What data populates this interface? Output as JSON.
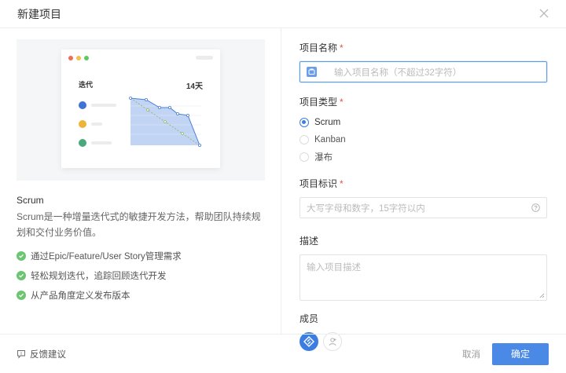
{
  "dialog": {
    "title": "新建项目"
  },
  "preview": {
    "card_label": "迭代",
    "card_days": "14天"
  },
  "template": {
    "name": "Scrum",
    "description": "Scrum是一种增量迭代式的敏捷开发方法，帮助团队持续规划和交付业务价值。",
    "features": [
      "通过Epic/Feature/User Story管理需求",
      "轻松规划迭代，追踪回顾迭代开发",
      "从产品角度定义发布版本"
    ]
  },
  "form": {
    "name_label": "项目名称",
    "name_placeholder": "输入项目名称（不超过32字符）",
    "type_label": "项目类型",
    "types": [
      "Scrum",
      "Kanban",
      "瀑布"
    ],
    "selected_type": "Scrum",
    "key_label": "项目标识",
    "key_placeholder": "大写字母和数字，15字符以内",
    "desc_label": "描述",
    "desc_placeholder": "输入项目描述",
    "members_label": "成员",
    "required_mark": "*"
  },
  "footer": {
    "feedback": "反馈建议",
    "cancel": "取消",
    "confirm": "确定"
  },
  "colors": {
    "accent": "#4a8ae6",
    "required": "#e5534b",
    "check": "#6cc570"
  }
}
